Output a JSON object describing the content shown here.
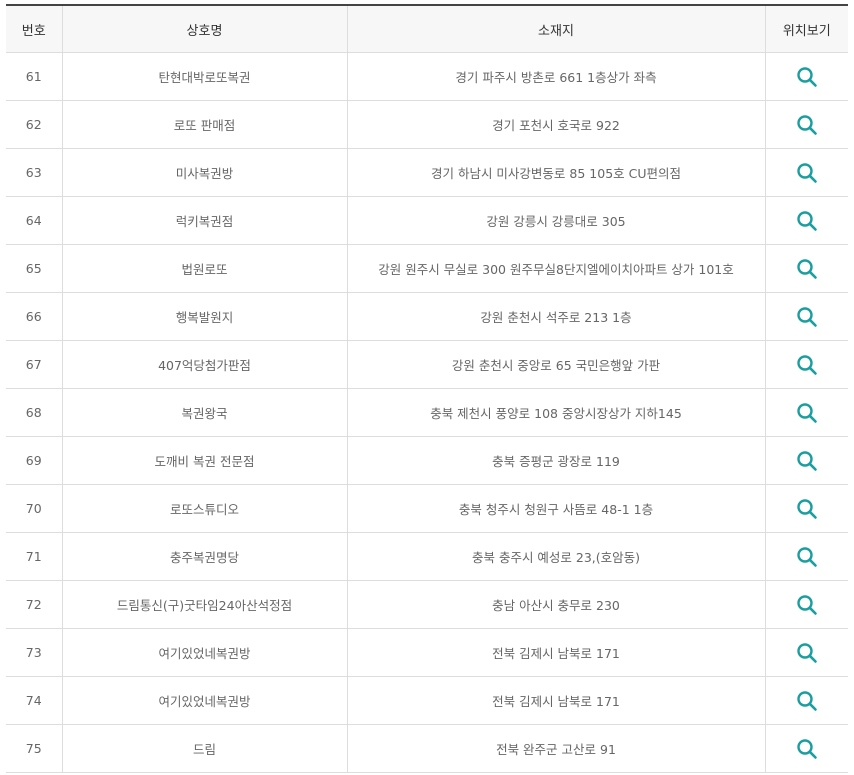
{
  "table": {
    "headers": [
      "번호",
      "상호명",
      "소재지",
      "위치보기"
    ],
    "icon": "search-icon",
    "accent_color": "#1a9e9e",
    "rows": [
      {
        "num": "61",
        "name": "탄현대박로또복권",
        "address": "경기 파주시 방촌로 661 1층상가 좌측"
      },
      {
        "num": "62",
        "name": "로또 판매점",
        "address": "경기 포천시 호국로 922"
      },
      {
        "num": "63",
        "name": "미사복권방",
        "address": "경기 하남시 미사강변동로 85 105호 CU편의점"
      },
      {
        "num": "64",
        "name": "럭키복권점",
        "address": "강원 강릉시 강릉대로 305"
      },
      {
        "num": "65",
        "name": "법원로또",
        "address": "강원 원주시 무실로 300 원주무실8단지엘에이치아파트 상가 101호"
      },
      {
        "num": "66",
        "name": "행복발원지",
        "address": "강원 춘천시 석주로 213 1층"
      },
      {
        "num": "67",
        "name": "407억당첨가판점",
        "address": "강원 춘천시 중앙로 65 국민은행앞 가판"
      },
      {
        "num": "68",
        "name": "복권왕국",
        "address": "충북 제천시 풍양로 108 중앙시장상가 지하145"
      },
      {
        "num": "69",
        "name": "도깨비 복권 전문점",
        "address": "충북 증평군 광장로 119"
      },
      {
        "num": "70",
        "name": "로또스튜디오",
        "address": "충북 청주시 청원구 사뜸로 48-1 1층"
      },
      {
        "num": "71",
        "name": "충주복권명당",
        "address": "충북 충주시 예성로 23,(호암동)"
      },
      {
        "num": "72",
        "name": "드림통신(구)굿타임24아산석정점",
        "address": "충남 아산시 충무로 230"
      },
      {
        "num": "73",
        "name": "여기있었네복권방",
        "address": "전북 김제시 남북로 171"
      },
      {
        "num": "74",
        "name": "여기있었네복권방",
        "address": "전북 김제시 남북로 171"
      },
      {
        "num": "75",
        "name": "드림",
        "address": "전북 완주군 고산로 91"
      }
    ]
  }
}
